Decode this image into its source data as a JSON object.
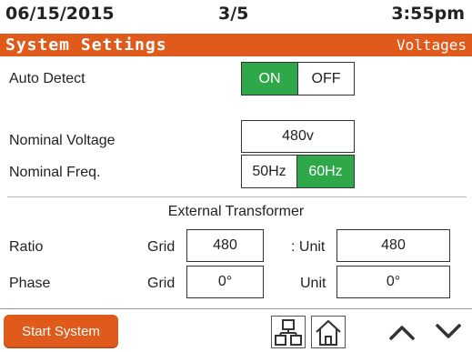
{
  "status_bar": {
    "date": "06/15/2015",
    "page": "3/5",
    "time": "3:55pm"
  },
  "title_bar": {
    "title": "System Settings",
    "section": "Voltages"
  },
  "auto_detect": {
    "label": "Auto Detect",
    "on_label": "ON",
    "off_label": "OFF",
    "selected": "ON"
  },
  "nominal_voltage": {
    "label": "Nominal Voltage",
    "value": "480v"
  },
  "nominal_freq": {
    "label": "Nominal Freq.",
    "option_50": "50Hz",
    "option_60": "60Hz",
    "selected": "60Hz"
  },
  "external_transformer": {
    "heading": "External Transformer",
    "ratio": {
      "label": "Ratio",
      "grid_label": "Grid",
      "grid_value": "480",
      "unit_label": ": Unit",
      "unit_value": "480"
    },
    "phase": {
      "label": "Phase",
      "grid_label": "Grid",
      "grid_value": "0°",
      "unit_label": "Unit",
      "unit_value": "0°"
    }
  },
  "footer": {
    "start_button": "Start System",
    "icons": [
      "network-icon",
      "home-icon",
      "chevron-up-icon",
      "chevron-down-icon"
    ]
  },
  "colors": {
    "accent_orange": "#e05a1c",
    "active_green": "#2fa84a"
  }
}
